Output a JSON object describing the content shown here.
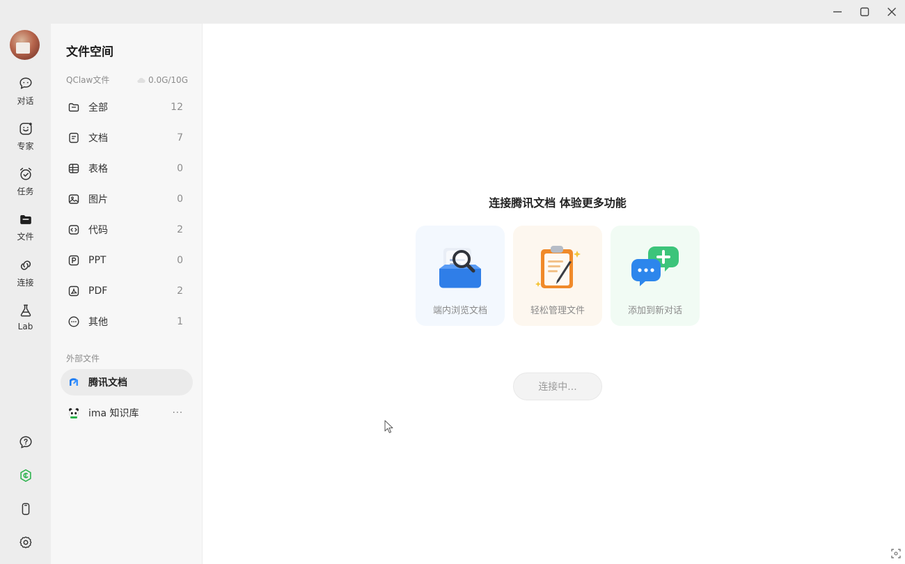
{
  "window": {
    "controls": [
      "minimize-icon",
      "maximize-icon",
      "close-icon"
    ]
  },
  "rail": {
    "items": [
      {
        "label": "对话",
        "icon": "chat-bubble-icon"
      },
      {
        "label": "专家",
        "icon": "expert-face-icon"
      },
      {
        "label": "任务",
        "icon": "task-alarm-icon"
      },
      {
        "label": "文件",
        "icon": "folder-icon",
        "active": true
      },
      {
        "label": "连接",
        "icon": "link-icon"
      },
      {
        "label": "Lab",
        "icon": "flask-icon"
      }
    ],
    "bottom": [
      "help-icon",
      "shield-icon",
      "phone-icon",
      "settings-icon"
    ],
    "accent": "#2bb24c"
  },
  "sidebar": {
    "title": "文件空间",
    "storage": {
      "label": "QClaw文件",
      "usage": "0.0G/10G"
    },
    "categories": [
      {
        "name": "全部",
        "count": "12",
        "icon": "folder-outline-icon"
      },
      {
        "name": "文档",
        "count": "7",
        "icon": "document-icon"
      },
      {
        "name": "表格",
        "count": "0",
        "icon": "table-icon"
      },
      {
        "name": "图片",
        "count": "0",
        "icon": "image-icon"
      },
      {
        "name": "代码",
        "count": "2",
        "icon": "code-icon"
      },
      {
        "name": "PPT",
        "count": "0",
        "icon": "ppt-icon"
      },
      {
        "name": "PDF",
        "count": "2",
        "icon": "pdf-icon"
      },
      {
        "name": "其他",
        "count": "1",
        "icon": "more-circle-icon"
      }
    ],
    "external_label": "外部文件",
    "external": [
      {
        "name": "腾讯文档",
        "icon": "tencent-docs-icon",
        "active": true
      },
      {
        "name": "ima 知识库",
        "icon": "panda-icon",
        "more": "···"
      }
    ]
  },
  "main": {
    "title": "连接腾讯文档 体验更多功能",
    "cards": [
      {
        "caption": "端内浏览文档",
        "icon": "search-document-icon"
      },
      {
        "caption": "轻松管理文件",
        "icon": "clipboard-pen-icon"
      },
      {
        "caption": "添加到新对话",
        "icon": "chat-add-icon"
      }
    ],
    "connect_button": "连接中..."
  }
}
